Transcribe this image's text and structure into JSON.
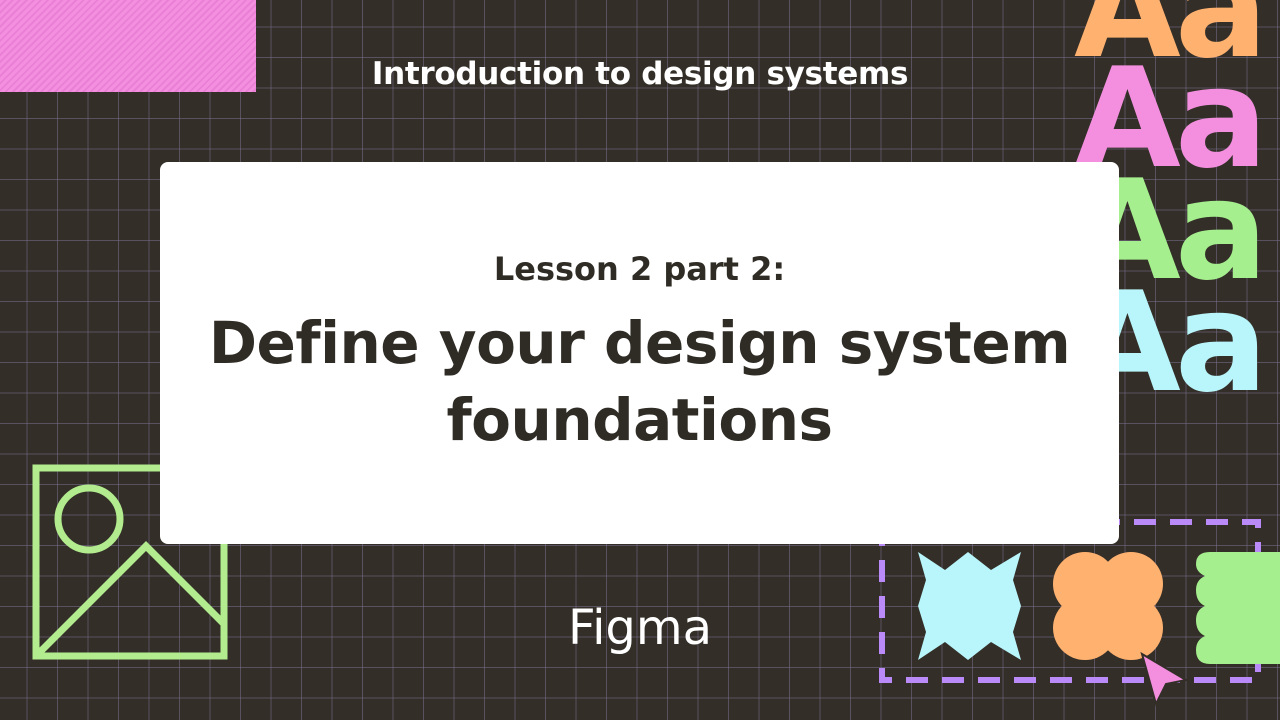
{
  "header": {
    "course_title": "Introduction to design systems"
  },
  "card": {
    "lesson_label": "Lesson 2 part 2:",
    "lesson_title_line1": "Define your design system",
    "lesson_title_line2": "foundations"
  },
  "footer": {
    "brand": "Figma"
  },
  "decor": {
    "type_samples": [
      "Aa",
      "Aa",
      "Aa",
      "Aa"
    ],
    "type_colors": [
      "#ffb170",
      "#f48fe0",
      "#a6ef8e",
      "#b9f6fb"
    ],
    "colors": {
      "background": "#332f28",
      "green": "#b2ec8e",
      "purple": "#b98af8",
      "cyan": "#b9f6fb",
      "orange": "#ffb170",
      "pink": "#f48fe0"
    },
    "icons": [
      "image-placeholder-icon",
      "bowtie-shape-icon",
      "flower-shape-icon",
      "wavy-shape-icon",
      "cursor-pointer-icon"
    ]
  }
}
